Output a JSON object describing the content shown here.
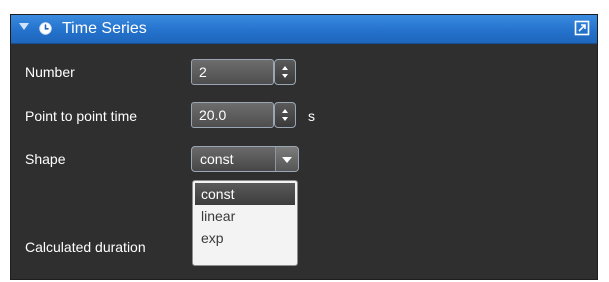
{
  "panel": {
    "title": "Time Series",
    "icons": {
      "collapse": "triangle-down-icon",
      "section": "clock-icon",
      "popout": "popout-icon"
    }
  },
  "fields": {
    "number": {
      "label": "Number",
      "value": "2"
    },
    "point_time": {
      "label": "Point to point time",
      "value": "20.0",
      "unit": "s"
    },
    "shape": {
      "label": "Shape",
      "value": "const",
      "options": [
        "const",
        "linear",
        "exp"
      ],
      "highlighted": "const"
    },
    "duration": {
      "label": "Calculated duration"
    }
  },
  "colors": {
    "panel_bg": "#2f2f2f",
    "header_blue": "#2472cc",
    "text": "#ffffff",
    "dropdown_bg": "#f3f3f3"
  }
}
